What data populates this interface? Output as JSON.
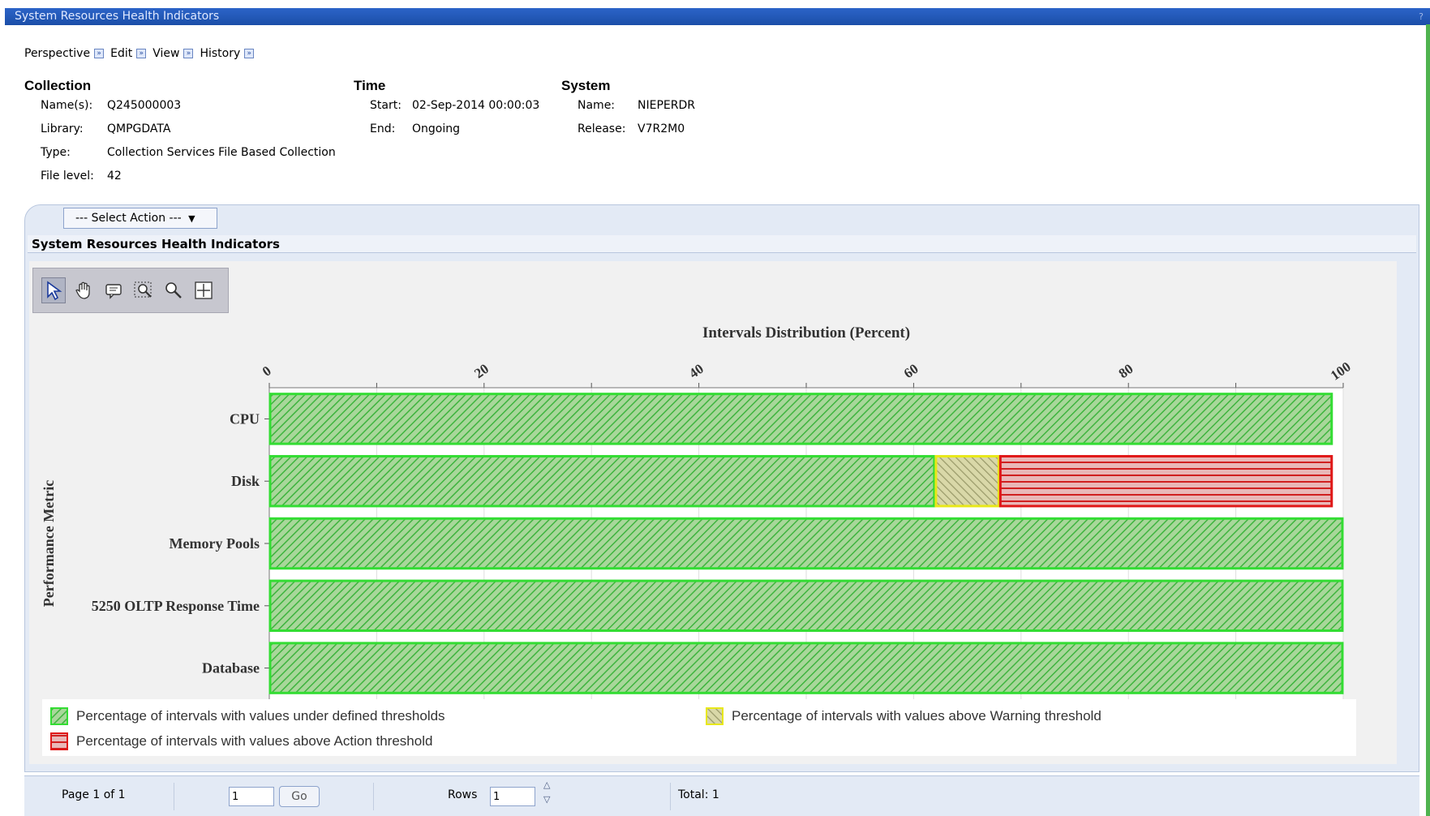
{
  "window": {
    "title": "System Resources Health Indicators",
    "corner": "?"
  },
  "menu": [
    {
      "label": "Perspective"
    },
    {
      "label": "Edit"
    },
    {
      "label": "View"
    },
    {
      "label": "History"
    }
  ],
  "collection": {
    "heading": "Collection",
    "names_label": "Name(s):",
    "names_value": "Q245000003",
    "library_label": "Library:",
    "library_value": "QMPGDATA",
    "type_label": "Type:",
    "type_value": "Collection Services File Based Collection",
    "file_level_label": "File level:",
    "file_level_value": "42"
  },
  "time": {
    "heading": "Time",
    "start_label": "Start:",
    "start_value": "02-Sep-2014 00:00:03",
    "end_label": "End:",
    "end_value": "Ongoing"
  },
  "system": {
    "heading": "System",
    "name_label": "Name:",
    "name_value": "NIEPERDR",
    "release_label": "Release:",
    "release_value": "V7R2M0"
  },
  "select_action": "--- Select Action ---",
  "section_title": "System Resources Health Indicators",
  "tools": [
    "select-icon",
    "pan-hand-icon",
    "tooltip-icon",
    "zoom-box-icon",
    "zoom-icon",
    "crosshair-icon"
  ],
  "colors": {
    "green": "#33dd33",
    "green_fill": "#9ccf8a",
    "yellow": "#e8e81a",
    "yellow_fill": "#cfd39a",
    "red": "#e01818",
    "red_fill": "#e8a0a0"
  },
  "chart_data": {
    "type": "bar",
    "orientation": "horizontal",
    "stacked": true,
    "title": "Intervals Distribution (Percent)",
    "xlabel": "Intervals Distribution (Percent)",
    "ylabel": "Performance Metric",
    "xlim": [
      0,
      100
    ],
    "x_ticks": [
      "0",
      "20",
      "40",
      "60",
      "80",
      "100"
    ],
    "grid": true,
    "categories": [
      "CPU",
      "Disk",
      "Memory Pools",
      "5250 OLTP Response Time",
      "Database"
    ],
    "series": [
      {
        "name": "Percentage of intervals with values under defined thresholds",
        "values": [
          99,
          62,
          100,
          100,
          100
        ]
      },
      {
        "name": "Percentage of intervals with values above Warning threshold",
        "values": [
          0,
          6,
          0,
          0,
          0
        ]
      },
      {
        "name": "Percentage of intervals with values above Action threshold",
        "values": [
          0,
          31,
          0,
          0,
          0
        ]
      }
    ],
    "legend_position": "bottom"
  },
  "footer": {
    "page_text": "Page 1 of 1",
    "page_input": "1",
    "go_label": "Go",
    "rows_label": "Rows",
    "rows_input": "1",
    "total_text": "Total: 1"
  }
}
